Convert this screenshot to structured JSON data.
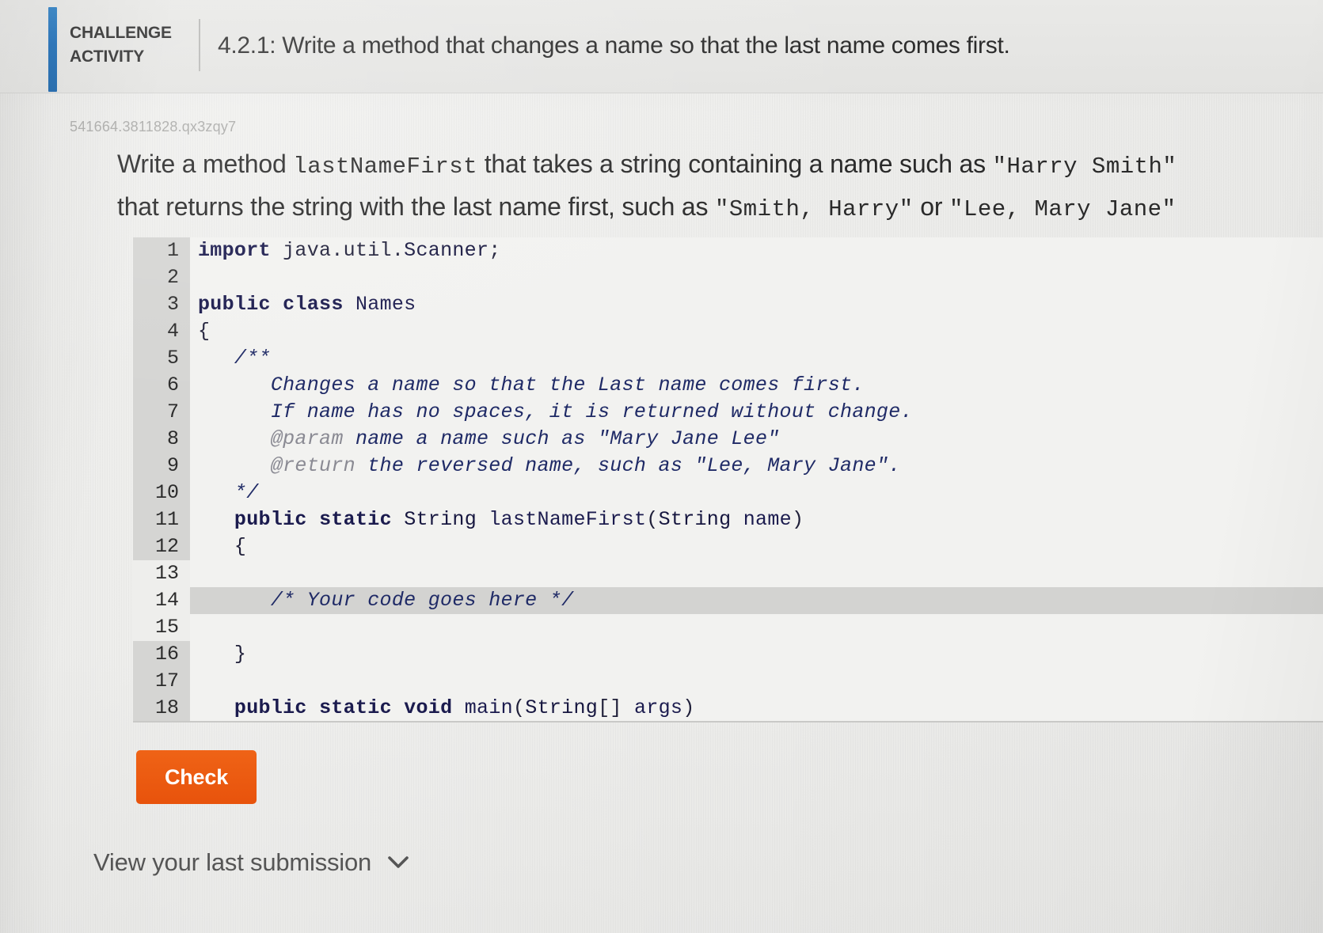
{
  "header": {
    "challenge_label_line1": "CHALLENGE",
    "challenge_label_line2": "ACTIVITY",
    "activity_title": "4.2.1: Write a method that changes a name so that the last name comes first."
  },
  "problem_id": "541664.3811828.qx3zqy7",
  "prompt": {
    "line1_a": "Write a method ",
    "line1_mono1": "lastNameFirst",
    "line1_b": " that takes a string containing a name such as ",
    "line1_mono2": "\"Harry Smith\"",
    "line2_a": "that returns the string with the last name first, such as ",
    "line2_mono1": "\"Smith, Harry\"",
    "line2_b": " or ",
    "line2_mono2": "\"Lee, Mary Jane\""
  },
  "editor": {
    "lines": [
      {
        "num": "1",
        "editable": false,
        "active": false,
        "text": "import java.util.Scanner;"
      },
      {
        "num": "2",
        "editable": false,
        "active": false,
        "text": ""
      },
      {
        "num": "3",
        "editable": false,
        "active": false,
        "text": "public class Names"
      },
      {
        "num": "4",
        "editable": false,
        "active": false,
        "text": "{"
      },
      {
        "num": "5",
        "editable": false,
        "active": false,
        "text": "   /**"
      },
      {
        "num": "6",
        "editable": false,
        "active": false,
        "text": "      Changes a name so that the Last name comes first."
      },
      {
        "num": "7",
        "editable": false,
        "active": false,
        "text": "      If name has no spaces, it is returned without change."
      },
      {
        "num": "8",
        "editable": false,
        "active": false,
        "text": "      @param name a name such as \"Mary Jane Lee\""
      },
      {
        "num": "9",
        "editable": false,
        "active": false,
        "text": "      @return the reversed name, such as \"Lee, Mary Jane\"."
      },
      {
        "num": "10",
        "editable": false,
        "active": false,
        "text": "   */"
      },
      {
        "num": "11",
        "editable": false,
        "active": false,
        "text": "   public static String lastNameFirst(String name)"
      },
      {
        "num": "12",
        "editable": false,
        "active": false,
        "text": "   {"
      },
      {
        "num": "13",
        "editable": true,
        "active": false,
        "text": ""
      },
      {
        "num": "14",
        "editable": true,
        "active": true,
        "text": "      /* Your code goes here */"
      },
      {
        "num": "15",
        "editable": true,
        "active": false,
        "text": ""
      },
      {
        "num": "16",
        "editable": false,
        "active": false,
        "text": "   }"
      },
      {
        "num": "17",
        "editable": false,
        "active": false,
        "text": ""
      },
      {
        "num": "18",
        "editable": false,
        "active": false,
        "text": "   public static void main(String[] args)"
      }
    ]
  },
  "check_button_label": "Check",
  "last_submission": {
    "label": "View your last submission",
    "icon": "chevron-down-icon"
  },
  "colors": {
    "accent_blue": "#1668b5",
    "check_orange": "#e8530c",
    "gutter_locked": "#d5d5d3",
    "gutter_editable": "#eeeeec",
    "active_line": "#d3d3d1",
    "code_keyword": "#1b1b4e",
    "code_comment": "#1f2a66",
    "code_tag": "#8a8a93",
    "page_background": "#ededeb"
  }
}
